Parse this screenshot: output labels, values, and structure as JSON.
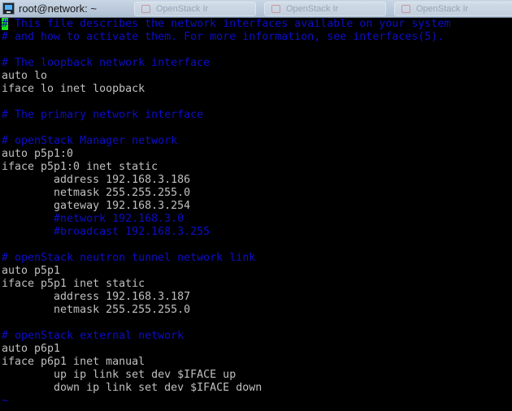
{
  "window": {
    "title": "root@network: ~",
    "ghost_tabs": [
      "OpenStack Ir",
      "OpenStack Ir",
      "OpenStack Ir"
    ]
  },
  "colors": {
    "background": "#000000",
    "text": "#c0c0c0",
    "comment": "#0d0dc8",
    "cursor": "#16e016"
  },
  "terminal": {
    "cursor_char": "#",
    "lines": [
      {
        "type": "comment",
        "text": " This file describes the network interfaces available on your system"
      },
      {
        "type": "comment",
        "text": "# and how to activate them. For more information, see interfaces(5)."
      },
      {
        "type": "blank",
        "text": ""
      },
      {
        "type": "comment",
        "text": "# The loopback network interface"
      },
      {
        "type": "code",
        "text": "auto lo"
      },
      {
        "type": "code",
        "text": "iface lo inet loopback"
      },
      {
        "type": "blank",
        "text": ""
      },
      {
        "type": "comment",
        "text": "# The primary network interface"
      },
      {
        "type": "blank",
        "text": ""
      },
      {
        "type": "comment",
        "text": "# openStack Manager network"
      },
      {
        "type": "code",
        "text": "auto p5p1:0"
      },
      {
        "type": "code",
        "text": "iface p5p1:0 inet static"
      },
      {
        "type": "code",
        "text": "        address 192.168.3.186"
      },
      {
        "type": "code",
        "text": "        netmask 255.255.255.0"
      },
      {
        "type": "code",
        "text": "        gateway 192.168.3.254"
      },
      {
        "type": "comment",
        "text": "        #network 192.168.3.0"
      },
      {
        "type": "comment",
        "text": "        #broadcast 192.168.3.255"
      },
      {
        "type": "blank",
        "text": ""
      },
      {
        "type": "comment",
        "text": "# openStack neutron tunnel network link"
      },
      {
        "type": "code",
        "text": "auto p5p1"
      },
      {
        "type": "code",
        "text": "iface p5p1 inet static"
      },
      {
        "type": "code",
        "text": "        address 192.168.3.187"
      },
      {
        "type": "code",
        "text": "        netmask 255.255.255.0"
      },
      {
        "type": "blank",
        "text": ""
      },
      {
        "type": "comment",
        "text": "# openStack external network"
      },
      {
        "type": "code",
        "text": "auto p6p1"
      },
      {
        "type": "code",
        "text": "iface p6p1 inet manual"
      },
      {
        "type": "code",
        "text": "        up ip link set dev $IFACE up"
      },
      {
        "type": "code",
        "text": "        down ip link set dev $IFACE down"
      },
      {
        "type": "tilde",
        "text": "~"
      }
    ]
  }
}
